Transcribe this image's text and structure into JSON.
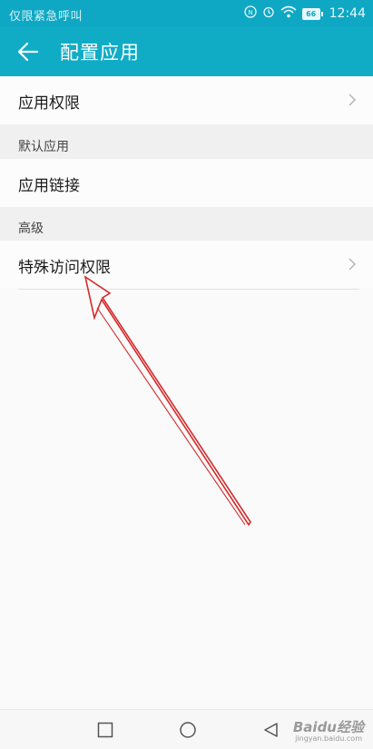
{
  "status_bar": {
    "carrier_text": "仅限紧急呼叫",
    "battery_level": "66",
    "time": "12:44",
    "icons": [
      "nfc-icon",
      "alarm-icon",
      "wifi-icon",
      "battery-icon"
    ]
  },
  "app_bar": {
    "title": "配置应用",
    "back_icon": "arrow-left-icon",
    "color": "#10acc6"
  },
  "list": {
    "app_permissions": "应用权限",
    "section_default_apps": "默认应用",
    "app_links": "应用链接",
    "section_advanced": "高级",
    "special_access": "特殊访问权限"
  },
  "nav_bar": {
    "buttons": [
      "recent-apps-icon",
      "home-icon",
      "back-triangle-icon"
    ]
  },
  "annotation": {
    "color": "#d42a2a"
  },
  "watermark": {
    "text": "Baidu经验",
    "sub": "jingyan.baidu.com"
  }
}
